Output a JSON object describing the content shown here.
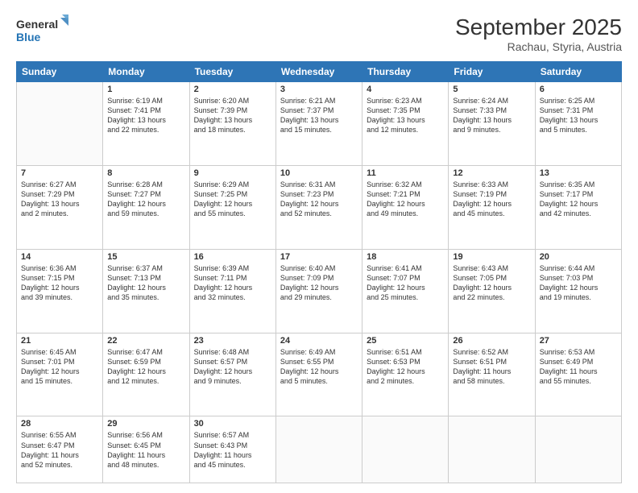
{
  "header": {
    "logo_line1": "General",
    "logo_line2": "Blue",
    "month": "September 2025",
    "location": "Rachau, Styria, Austria"
  },
  "weekdays": [
    "Sunday",
    "Monday",
    "Tuesday",
    "Wednesday",
    "Thursday",
    "Friday",
    "Saturday"
  ],
  "weeks": [
    [
      {
        "day": "",
        "info": ""
      },
      {
        "day": "1",
        "info": "Sunrise: 6:19 AM\nSunset: 7:41 PM\nDaylight: 13 hours\nand 22 minutes."
      },
      {
        "day": "2",
        "info": "Sunrise: 6:20 AM\nSunset: 7:39 PM\nDaylight: 13 hours\nand 18 minutes."
      },
      {
        "day": "3",
        "info": "Sunrise: 6:21 AM\nSunset: 7:37 PM\nDaylight: 13 hours\nand 15 minutes."
      },
      {
        "day": "4",
        "info": "Sunrise: 6:23 AM\nSunset: 7:35 PM\nDaylight: 13 hours\nand 12 minutes."
      },
      {
        "day": "5",
        "info": "Sunrise: 6:24 AM\nSunset: 7:33 PM\nDaylight: 13 hours\nand 9 minutes."
      },
      {
        "day": "6",
        "info": "Sunrise: 6:25 AM\nSunset: 7:31 PM\nDaylight: 13 hours\nand 5 minutes."
      }
    ],
    [
      {
        "day": "7",
        "info": "Sunrise: 6:27 AM\nSunset: 7:29 PM\nDaylight: 13 hours\nand 2 minutes."
      },
      {
        "day": "8",
        "info": "Sunrise: 6:28 AM\nSunset: 7:27 PM\nDaylight: 12 hours\nand 59 minutes."
      },
      {
        "day": "9",
        "info": "Sunrise: 6:29 AM\nSunset: 7:25 PM\nDaylight: 12 hours\nand 55 minutes."
      },
      {
        "day": "10",
        "info": "Sunrise: 6:31 AM\nSunset: 7:23 PM\nDaylight: 12 hours\nand 52 minutes."
      },
      {
        "day": "11",
        "info": "Sunrise: 6:32 AM\nSunset: 7:21 PM\nDaylight: 12 hours\nand 49 minutes."
      },
      {
        "day": "12",
        "info": "Sunrise: 6:33 AM\nSunset: 7:19 PM\nDaylight: 12 hours\nand 45 minutes."
      },
      {
        "day": "13",
        "info": "Sunrise: 6:35 AM\nSunset: 7:17 PM\nDaylight: 12 hours\nand 42 minutes."
      }
    ],
    [
      {
        "day": "14",
        "info": "Sunrise: 6:36 AM\nSunset: 7:15 PM\nDaylight: 12 hours\nand 39 minutes."
      },
      {
        "day": "15",
        "info": "Sunrise: 6:37 AM\nSunset: 7:13 PM\nDaylight: 12 hours\nand 35 minutes."
      },
      {
        "day": "16",
        "info": "Sunrise: 6:39 AM\nSunset: 7:11 PM\nDaylight: 12 hours\nand 32 minutes."
      },
      {
        "day": "17",
        "info": "Sunrise: 6:40 AM\nSunset: 7:09 PM\nDaylight: 12 hours\nand 29 minutes."
      },
      {
        "day": "18",
        "info": "Sunrise: 6:41 AM\nSunset: 7:07 PM\nDaylight: 12 hours\nand 25 minutes."
      },
      {
        "day": "19",
        "info": "Sunrise: 6:43 AM\nSunset: 7:05 PM\nDaylight: 12 hours\nand 22 minutes."
      },
      {
        "day": "20",
        "info": "Sunrise: 6:44 AM\nSunset: 7:03 PM\nDaylight: 12 hours\nand 19 minutes."
      }
    ],
    [
      {
        "day": "21",
        "info": "Sunrise: 6:45 AM\nSunset: 7:01 PM\nDaylight: 12 hours\nand 15 minutes."
      },
      {
        "day": "22",
        "info": "Sunrise: 6:47 AM\nSunset: 6:59 PM\nDaylight: 12 hours\nand 12 minutes."
      },
      {
        "day": "23",
        "info": "Sunrise: 6:48 AM\nSunset: 6:57 PM\nDaylight: 12 hours\nand 9 minutes."
      },
      {
        "day": "24",
        "info": "Sunrise: 6:49 AM\nSunset: 6:55 PM\nDaylight: 12 hours\nand 5 minutes."
      },
      {
        "day": "25",
        "info": "Sunrise: 6:51 AM\nSunset: 6:53 PM\nDaylight: 12 hours\nand 2 minutes."
      },
      {
        "day": "26",
        "info": "Sunrise: 6:52 AM\nSunset: 6:51 PM\nDaylight: 11 hours\nand 58 minutes."
      },
      {
        "day": "27",
        "info": "Sunrise: 6:53 AM\nSunset: 6:49 PM\nDaylight: 11 hours\nand 55 minutes."
      }
    ],
    [
      {
        "day": "28",
        "info": "Sunrise: 6:55 AM\nSunset: 6:47 PM\nDaylight: 11 hours\nand 52 minutes."
      },
      {
        "day": "29",
        "info": "Sunrise: 6:56 AM\nSunset: 6:45 PM\nDaylight: 11 hours\nand 48 minutes."
      },
      {
        "day": "30",
        "info": "Sunrise: 6:57 AM\nSunset: 6:43 PM\nDaylight: 11 hours\nand 45 minutes."
      },
      {
        "day": "",
        "info": ""
      },
      {
        "day": "",
        "info": ""
      },
      {
        "day": "",
        "info": ""
      },
      {
        "day": "",
        "info": ""
      }
    ]
  ]
}
